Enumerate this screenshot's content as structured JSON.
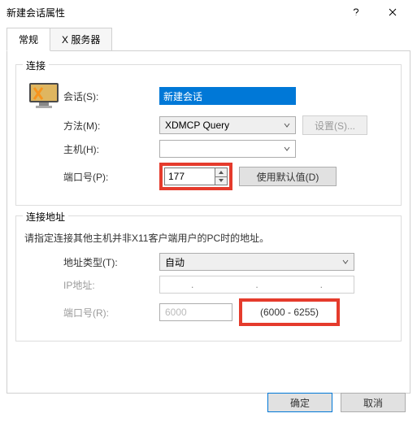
{
  "window": {
    "title": "新建会话属性"
  },
  "tabs": {
    "general": "常规",
    "xserver": "X 服务器"
  },
  "group_connect": {
    "legend": "连接",
    "session_label": "会话(S):",
    "session_value": "新建会话",
    "method_label": "方法(M):",
    "method_value": "XDMCP Query",
    "settings_btn": "设置(S)...",
    "host_label": "主机(H):",
    "host_value": "",
    "port_label": "端口号(P):",
    "port_value": "177",
    "default_btn": "使用默认值(D)"
  },
  "group_addr": {
    "legend": "连接地址",
    "desc": "请指定连接其他主机并非X11客户端用户的PC时的地址。",
    "addr_type_label": "地址类型(T):",
    "addr_type_value": "自动",
    "ip_label": "IP地址:",
    "port_label": "端口号(R):",
    "port_value": "6000",
    "port_range": "(6000 - 6255)"
  },
  "footer": {
    "ok": "确定",
    "cancel": "取消"
  }
}
